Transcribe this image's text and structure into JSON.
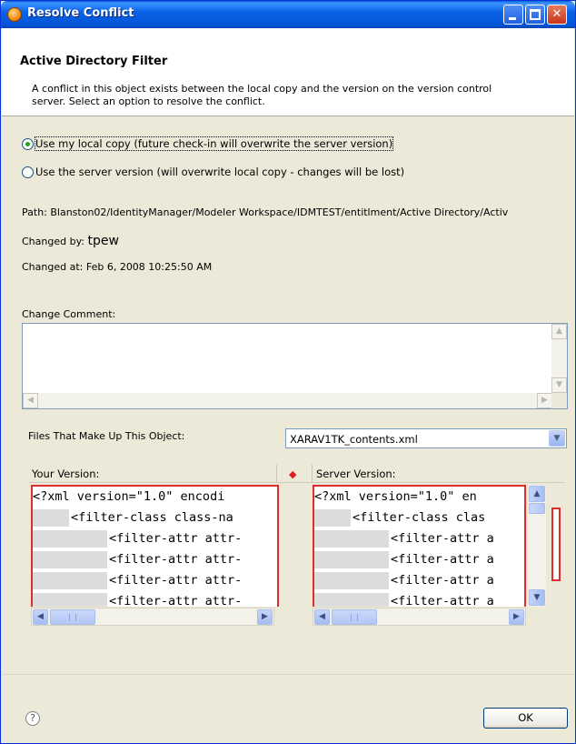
{
  "window": {
    "title": "Resolve Conflict",
    "minimize_glyph": "_",
    "maximize_glyph": "□",
    "close_glyph": "✕"
  },
  "header": {
    "title": "Active Directory Filter",
    "description": "A conflict in this object exists between the local copy and the version on the version control server.  Select an option to resolve the conflict."
  },
  "options": [
    {
      "label": "Use my local copy (future check-in will overwrite the server version)",
      "checked": true
    },
    {
      "label": "Use the server version (will overwrite local copy - changes will be lost)",
      "checked": false
    }
  ],
  "info": {
    "path": "Path:  Blanston02/IdentityManager/Modeler Workspace/IDMTEST/entitlment/Active Directory/Activ",
    "changed_by_label": "Changed by:",
    "changed_by_value": "tpew",
    "changed_at": "Changed at:  Feb 6, 2008 10:25:50 AM"
  },
  "comment": {
    "label": "Change Comment:",
    "value": ""
  },
  "files": {
    "label": "Files That Make Up This Object:",
    "selected": "XARAV1TK_contents.xml"
  },
  "compare": {
    "your_version_label": "Your Version:",
    "server_version_label": "Server Version:",
    "diff_marker": "◆",
    "your_lines": [
      "<?xml version=\"1.0\" encodi",
      "<filter-class class-na",
      "<filter-attr attr-",
      "<filter-attr attr-",
      "<filter-attr attr-",
      "<filter-attr attr-"
    ],
    "server_lines": [
      "<?xml version=\"1.0\" en",
      "<filter-class clas",
      "<filter-attr a",
      "<filter-attr a",
      "<filter-attr a",
      "<filter-attr a"
    ]
  },
  "footer": {
    "help_glyph": "?",
    "ok_label": "OK"
  },
  "colors": {
    "titlebar": "#0a63e6",
    "diff_border": "#e02c2c",
    "radio_selected": "#21a121"
  }
}
